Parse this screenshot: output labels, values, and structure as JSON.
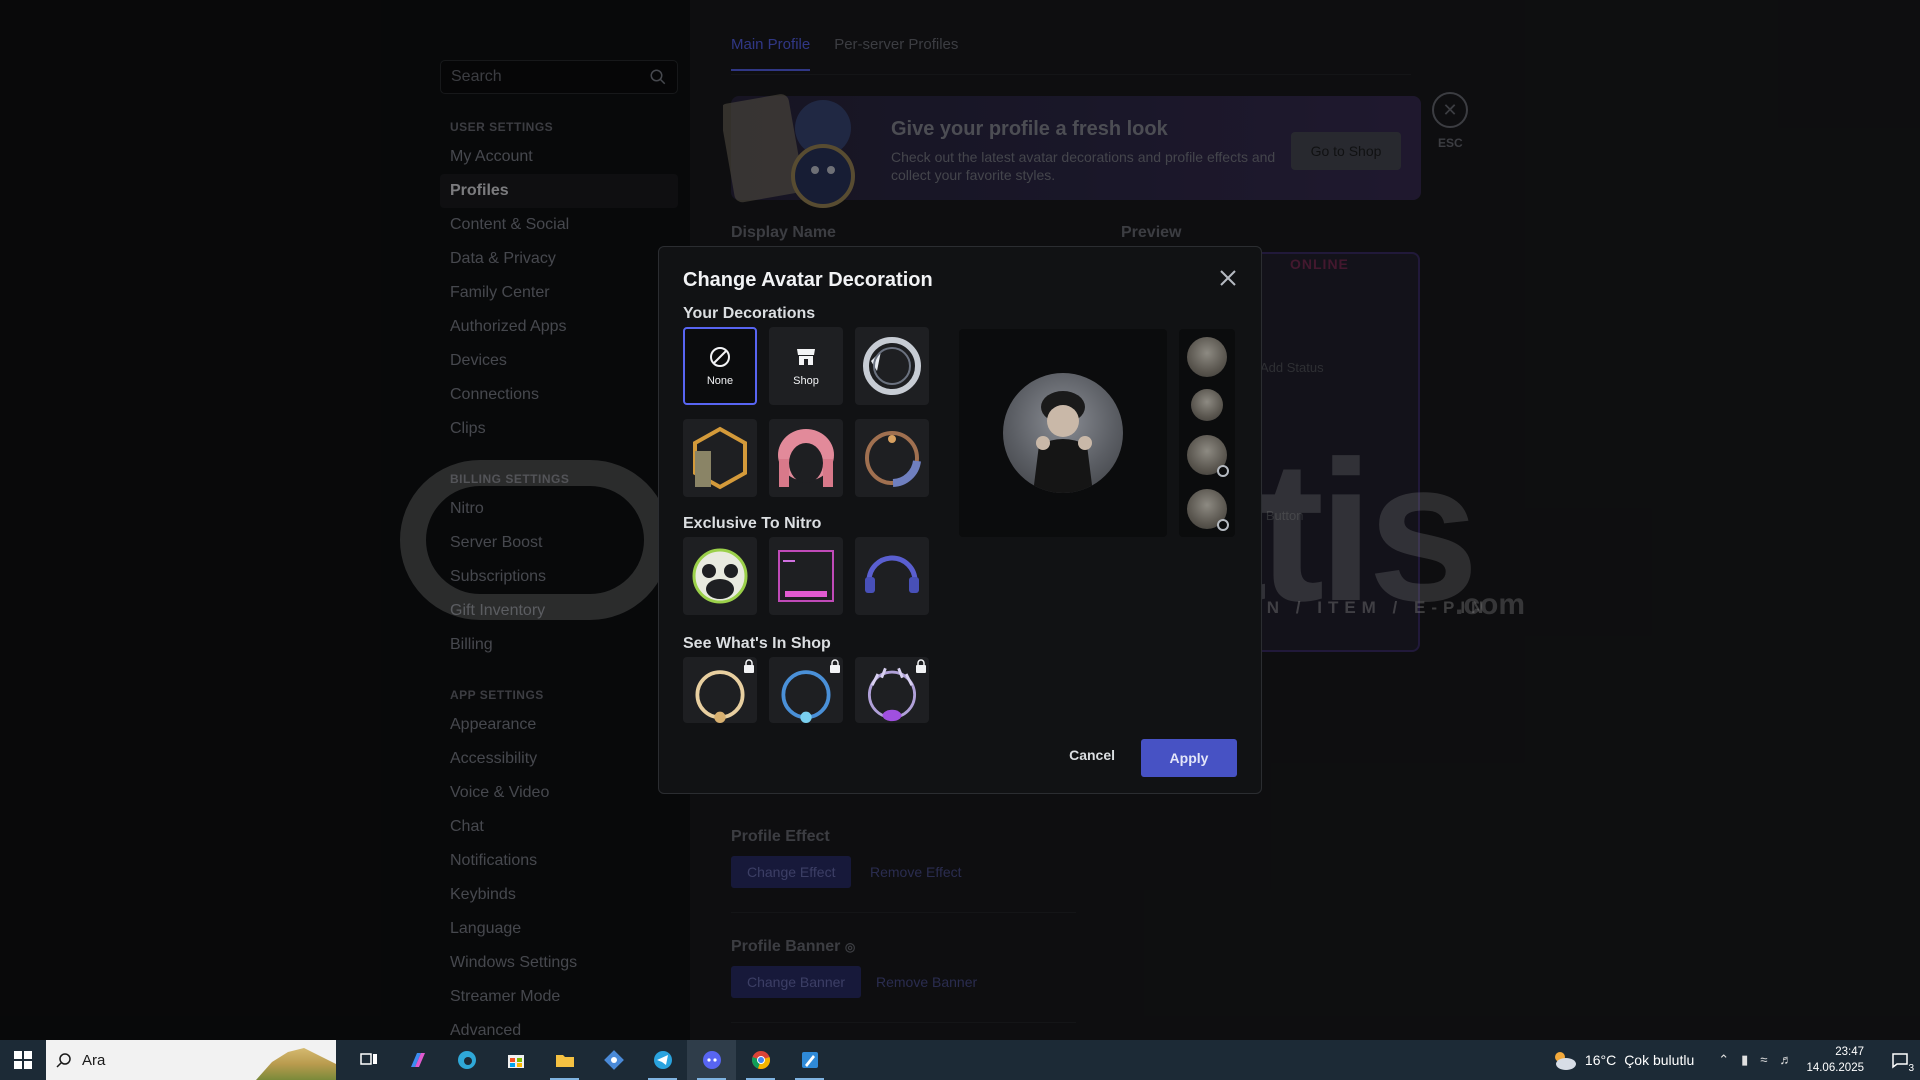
{
  "sidebar": {
    "search_placeholder": "Search",
    "user_settings_header": "User Settings",
    "user_items": [
      "My Account",
      "Profiles",
      "Content & Social",
      "Data & Privacy",
      "Family Center",
      "Authorized Apps",
      "Devices",
      "Connections",
      "Clips"
    ],
    "billing_header": "Billing Settings",
    "billing_items": [
      "Nitro",
      "Server Boost",
      "Subscriptions",
      "Gift Inventory",
      "Billing"
    ],
    "app_header": "App Settings",
    "app_items": [
      "Appearance",
      "Accessibility",
      "Voice & Video",
      "Chat",
      "Notifications",
      "Keybinds",
      "Language",
      "Windows Settings",
      "Streamer Mode",
      "Advanced"
    ]
  },
  "main": {
    "tabs": [
      "Main Profile",
      "Per-server Profiles"
    ],
    "banner": {
      "title": "Give your profile a fresh look",
      "desc": "Check out the latest avatar decorations and profile effects and collect your favorite styles.",
      "button": "Go to Shop"
    },
    "esc_label": "ESC",
    "display_name_label": "Display Name",
    "preview_label": "Preview",
    "online_text": "ONLINE",
    "add_status": "Add Status",
    "example_button": "e Button",
    "profile_effect_label": "Profile Effect",
    "change_effect": "Change Effect",
    "remove_effect": "Remove Effect",
    "profile_banner_label": "Profile Banner",
    "change_banner": "Change Banner",
    "remove_banner": "Remove Banner"
  },
  "modal": {
    "title": "Change Avatar Decoration",
    "your_decorations": "Your Decorations",
    "none_label": "None",
    "shop_label": "Shop",
    "exclusive_nitro": "Exclusive To Nitro",
    "see_shop": "See What's In Shop",
    "cancel": "Cancel",
    "apply": "Apply"
  },
  "watermark": {
    "brand": "itemsatis",
    "tagline": "HESAP / SKIN / ITEM / E-PIN",
    "suffix": ".com"
  },
  "taskbar": {
    "search_text": "Ara",
    "weather_temp": "16°C",
    "weather_desc": "Çok bulutlu",
    "time": "23:47",
    "date": "14.06.2025",
    "notif_count": "3"
  },
  "colors": {
    "accent": "#5865f2",
    "apply_bg": "#4752c4",
    "modal_bg": "#111214"
  }
}
